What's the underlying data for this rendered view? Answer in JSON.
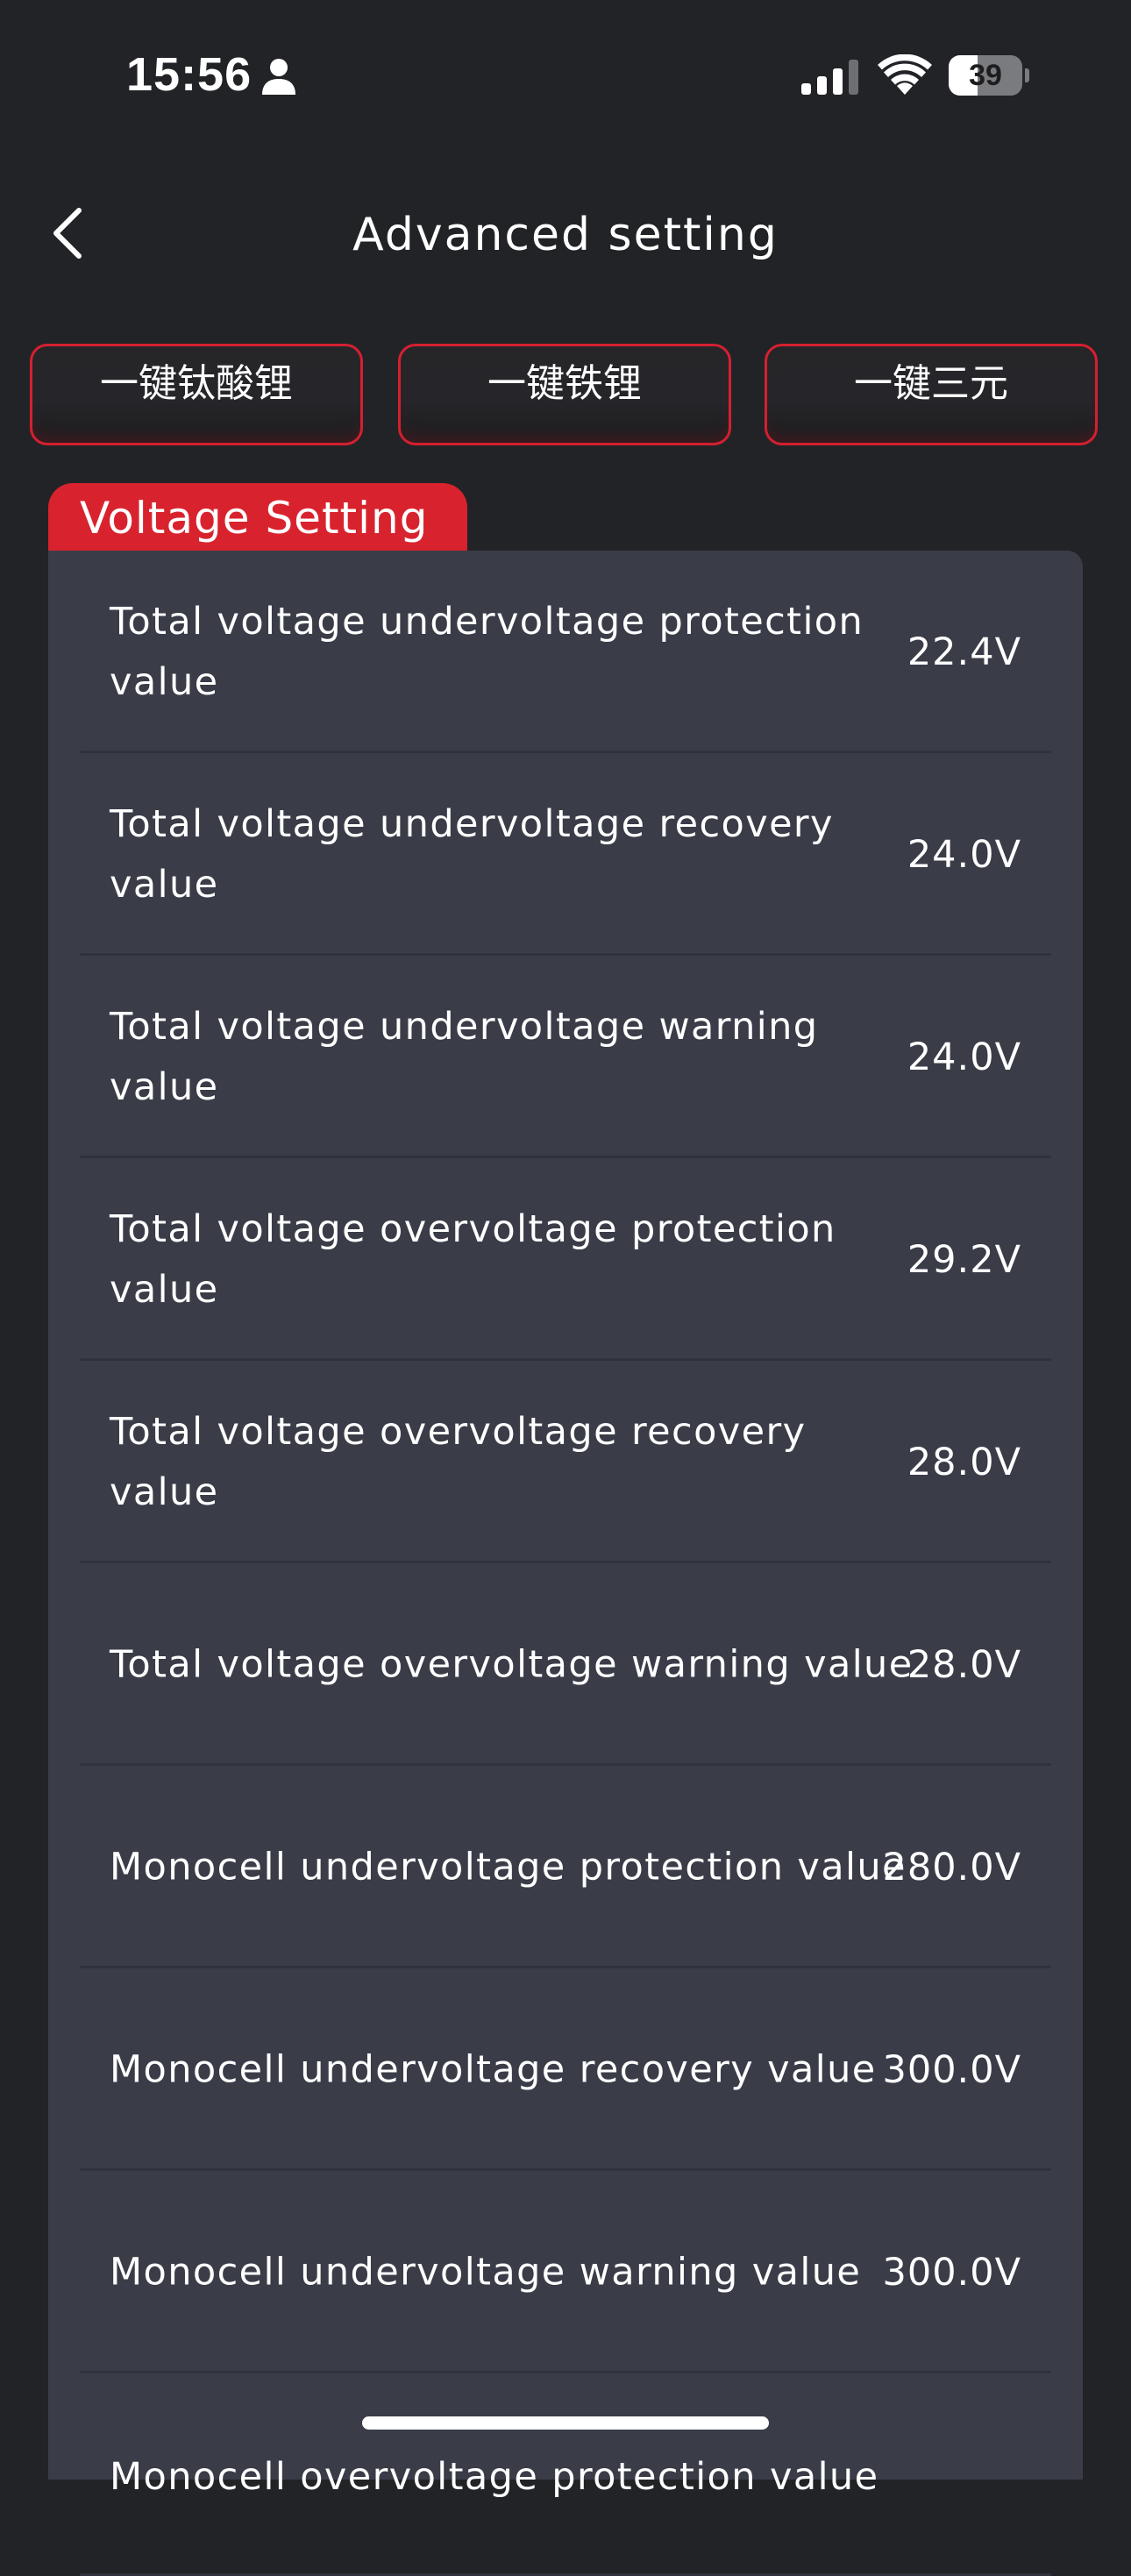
{
  "status_bar": {
    "time": "15:56",
    "battery_level": "39",
    "battery_fraction": 0.39,
    "icons": [
      "person-icon",
      "cellular-signal-icon",
      "wifi-icon",
      "battery-icon"
    ]
  },
  "header": {
    "title": "Advanced setting",
    "back_icon": "chevron-left-icon"
  },
  "presets": [
    {
      "label": "一键钛酸锂"
    },
    {
      "label": "一键铁锂"
    },
    {
      "label": "一键三元"
    }
  ],
  "section": {
    "title": "Voltage Setting"
  },
  "settings": [
    {
      "label": "Total voltage undervoltage protection value",
      "value": "22.4V"
    },
    {
      "label": "Total voltage undervoltage recovery value",
      "value": "24.0V"
    },
    {
      "label": "Total voltage undervoltage warning value",
      "value": "24.0V"
    },
    {
      "label": "Total voltage overvoltage protection value",
      "value": "29.2V"
    },
    {
      "label": "Total voltage overvoltage recovery value",
      "value": "28.0V"
    },
    {
      "label": "Total voltage overvoltage warning value",
      "value": "28.0V"
    },
    {
      "label": "Monocell undervoltage protection value",
      "value": "280.0V"
    },
    {
      "label": "Monocell undervoltage recovery value",
      "value": "300.0V"
    },
    {
      "label": "Monocell undervoltage warning value",
      "value": "300.0V"
    },
    {
      "label": "Monocell overvoltage protection value",
      "value": ""
    }
  ],
  "colors": {
    "background": "#222327",
    "card": "#3a3d48",
    "accent_red": "#d8232e",
    "text": "#ffffff"
  }
}
